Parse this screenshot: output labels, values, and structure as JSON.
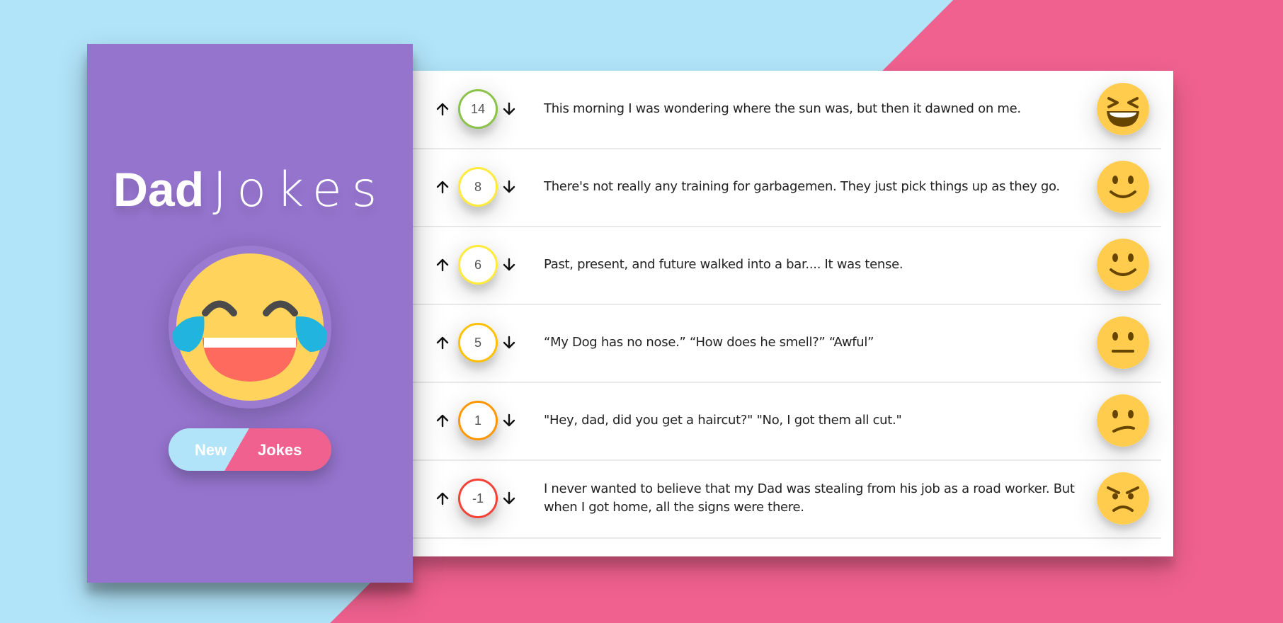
{
  "app": {
    "title_bold": "Dad",
    "title_light": "Jokes",
    "new_button": {
      "word1": "New",
      "word2": "Jokes"
    }
  },
  "colors": {
    "sidebar": "#9574cd",
    "bg_left": "#b1e4f9",
    "bg_right": "#f06190"
  },
  "jokes": [
    {
      "score": "14",
      "text": "This morning I was wondering where the sun was, but then it dawned on me.",
      "score_color": "#8bc34a",
      "face": "laughing-squint-face-icon"
    },
    {
      "score": "8",
      "text": "There's not really any training for garbagemen. They just pick things up as they go.",
      "score_color": "#ffeb3b",
      "face": "smiling-face-icon"
    },
    {
      "score": "6",
      "text": "Past, present, and future walked into a bar.... It was tense.",
      "score_color": "#ffeb3b",
      "face": "smiling-face-icon"
    },
    {
      "score": "5",
      "text": "“My Dog has no nose.” “How does he smell?” “Awful”",
      "score_color": "#ffc107",
      "face": "neutral-face-icon"
    },
    {
      "score": "1",
      "text": "\"Hey, dad, did you get a haircut?\" \"No, I got them all cut.\"",
      "score_color": "#ff9800",
      "face": "confused-face-icon"
    },
    {
      "score": "-1",
      "text": "I never wanted to believe that my Dad was stealing from his job as a road worker. But when I got home, all the signs were there.",
      "score_color": "#f44336",
      "face": "angry-face-icon"
    }
  ]
}
